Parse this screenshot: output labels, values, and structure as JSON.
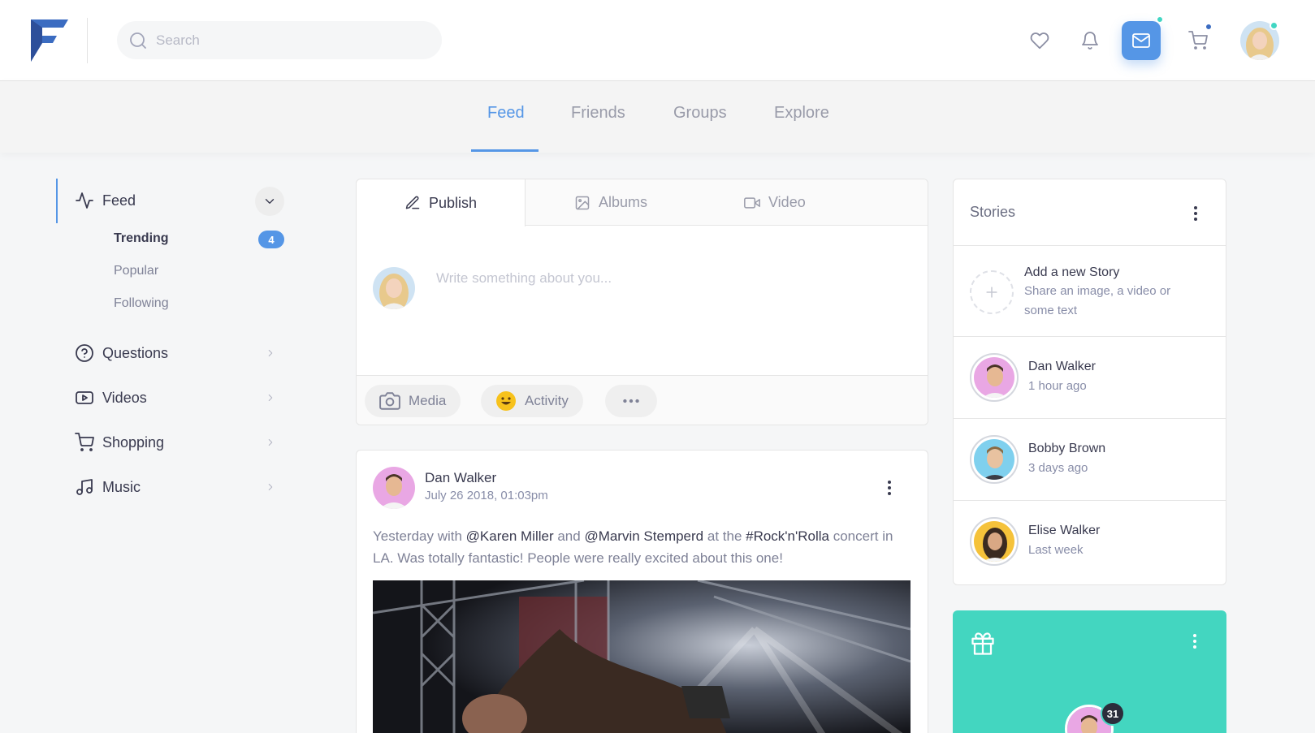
{
  "header": {
    "search": {
      "placeholder": "Search"
    },
    "icons": [
      "heart-icon",
      "bell-icon",
      "mail-icon",
      "cart-icon"
    ],
    "accent_color": "#5596e6",
    "notification_dot_color": "#41d6c3"
  },
  "subnav": {
    "tabs": [
      {
        "label": "Feed",
        "active": true
      },
      {
        "label": "Friends",
        "active": false
      },
      {
        "label": "Groups",
        "active": false
      },
      {
        "label": "Explore",
        "active": false
      }
    ]
  },
  "sidebar": {
    "items": [
      {
        "label": "Feed",
        "icon": "activity-icon",
        "expanded": true
      },
      {
        "label": "Questions",
        "icon": "help-circle-icon"
      },
      {
        "label": "Videos",
        "icon": "youtube-icon"
      },
      {
        "label": "Shopping",
        "icon": "cart-icon"
      },
      {
        "label": "Music",
        "icon": "music-icon"
      }
    ],
    "subitems": [
      {
        "label": "Trending",
        "badge": "4"
      },
      {
        "label": "Popular"
      },
      {
        "label": "Following"
      }
    ]
  },
  "composer": {
    "tabs": [
      {
        "label": "Publish",
        "icon": "pencil-icon"
      },
      {
        "label": "Albums",
        "icon": "image-icon"
      },
      {
        "label": "Video",
        "icon": "video-icon"
      }
    ],
    "placeholder": "Write something about you...",
    "actions": [
      {
        "label": "Media",
        "icon": "camera-icon"
      },
      {
        "label": "Activity",
        "icon": "smiley-icon"
      },
      {
        "label": "",
        "icon": "more-horizontal-icon"
      }
    ]
  },
  "post": {
    "author": "Dan Walker",
    "date": "July 26 2018, 01:03pm",
    "text_parts": {
      "p1": "Yesterday with ",
      "m1": "@Karen Miller",
      "p2": " and ",
      "m2": "@Marvin Stemperd",
      "p3": " at the ",
      "m3": "#Rock'n'Rolla",
      "p4": " concert in LA. Was totally fantastic! People were really excited about this one!"
    }
  },
  "stories": {
    "title": "Stories",
    "add": {
      "title": "Add a new Story",
      "subtitle": "Share an image, a video or some text"
    },
    "items": [
      {
        "name": "Dan Walker",
        "time": "1 hour ago"
      },
      {
        "name": "Bobby Brown",
        "time": "3 days ago"
      },
      {
        "name": "Elise Walker",
        "time": "Last week"
      }
    ]
  },
  "birthday": {
    "badge": "31",
    "color": "#43d6c0"
  }
}
